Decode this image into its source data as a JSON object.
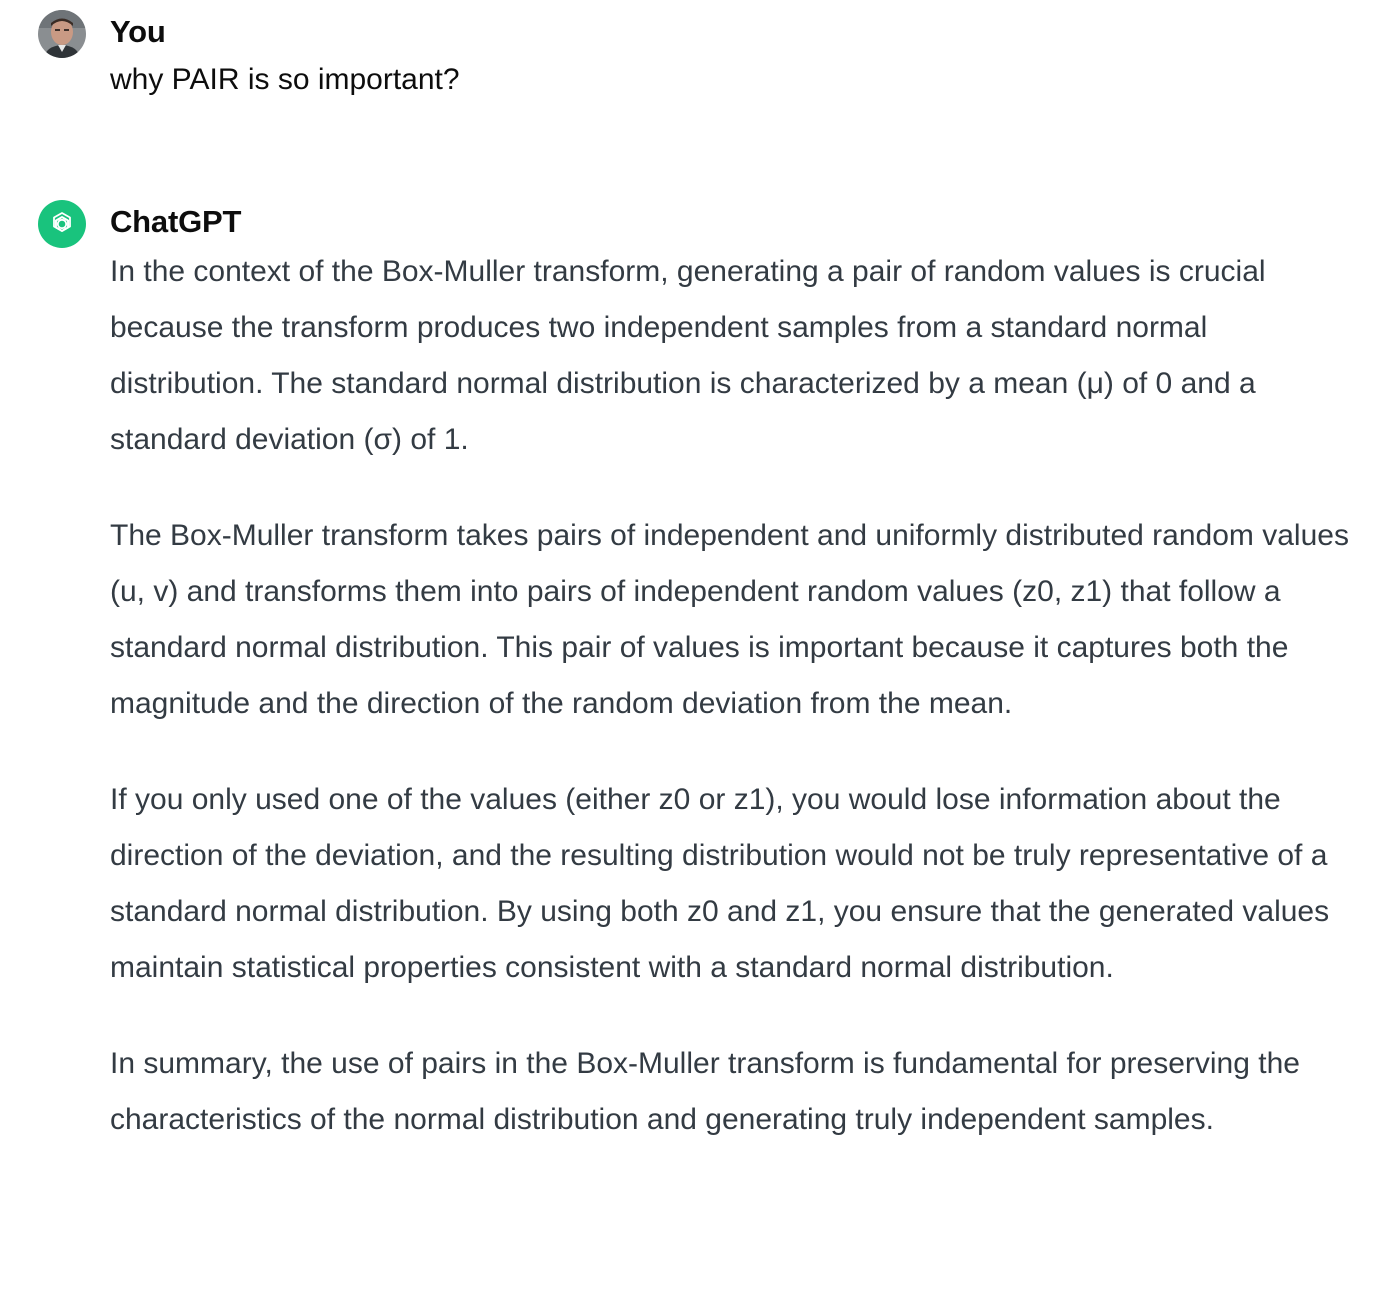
{
  "user_message": {
    "author": "You",
    "text": "why PAIR is so important?"
  },
  "assistant_message": {
    "author": "ChatGPT",
    "paragraphs": [
      "In the context of the Box-Muller transform, generating a pair of random values is crucial because the transform produces two independent samples from a standard normal distribution. The standard normal distribution is characterized by a mean (μ) of 0 and a standard deviation (σ) of 1.",
      "The Box-Muller transform takes pairs of independent and uniformly distributed random values (u, v) and transforms them into pairs of independent random values (z0, z1) that follow a standard normal distribution. This pair of values is important because it captures both the magnitude and the direction of the random deviation from the mean.",
      "If you only used one of the values (either z0 or z1), you would lose information about the direction of the deviation, and the resulting distribution would not be truly representative of a standard normal distribution. By using both z0 and z1, you ensure that the generated values maintain statistical properties consistent with a standard normal distribution.",
      "In summary, the use of pairs in the Box-Muller transform is fundamental for preserving the characteristics of the normal distribution and generating truly independent samples."
    ]
  },
  "colors": {
    "gpt_avatar_bg": "#19c37d",
    "body_text": "#333b43",
    "author_text": "#0d0d0d"
  },
  "icons": {
    "user_avatar": "user-photo-avatar",
    "gpt_avatar": "openai-logo-icon"
  }
}
